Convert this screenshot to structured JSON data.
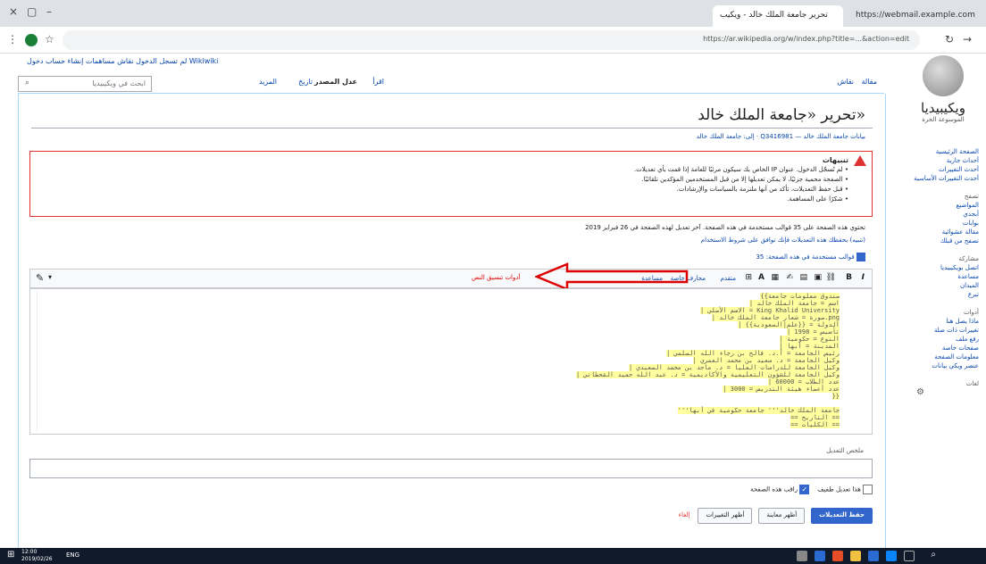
{
  "browser": {
    "tab_active_title": "تحرير جامعة الملك خالد - ويكيب",
    "tab_other_title": "https://webmail.example.com",
    "url": "https://ar.wikipedia.org/w/index.php?title=...&action=edit",
    "minimize": "–",
    "maximize": "▢",
    "close": "×"
  },
  "wiki": {
    "logo_title": "ويكيبيديا",
    "logo_subtitle": "الموسوعة الحرة",
    "user_tools": "Wikiwiki لم تسجل الدخول نقاش مساهمات إنشاء حساب دخول",
    "search_placeholder": "ابحث في ويكيبيديا",
    "tabs": [
      "مقالة",
      "نقاش",
      "اقرأ",
      "عدل المصدر",
      "تاريخ",
      "المزيد"
    ],
    "page_title": "تحرير «جامعة الملك خالد»",
    "breadcrumb": "بيانات جامعة الملك خالد — Q3416981 · إلى: جامعة الملك خالد",
    "sidebar": {
      "group1": [
        "الصفحة الرئيسية",
        "أحداث جارية",
        "أحدث التغييرات",
        "أحدث التغييرات الأساسية"
      ],
      "head2": "تصفح",
      "group2": [
        "المواضيع",
        "أبجدي",
        "بوابات",
        "مقالة عشوائية",
        "تصفح من قبلك"
      ],
      "head3": "مشاركة",
      "group3": [
        "اتصل بويكيبيديا",
        "مساعدة",
        "الميدان",
        "تبرع"
      ],
      "head4": "أدوات",
      "group4": [
        "ماذا يصل هنا",
        "تغييرات ذات صلة",
        "رفع ملف",
        "صفحات خاصة",
        "معلومات الصفحة",
        "عنصر ويكي بيانات"
      ],
      "head5": "لغات"
    }
  },
  "warning": {
    "title": "تنبيهات",
    "items": [
      "لم تُسجّل الدخول. عنوان IP الخاص بك سيكون مرئيًا للعامة إذا قمت بأي تعديلات.",
      "الصفحة محمية جزئيًا، لا يمكن تعديلها إلا من قبل المستخدمين المؤكدين تلقائيًا.",
      "قبل حفظ التعديلات، تأكد من أنها ملتزمة بالسياسات والإرشادات.",
      "شكرًا على المساهمة."
    ]
  },
  "notes": {
    "protection": "تحتوي هذه الصفحة على 35 قوالب مستخدمة في هذه الصفحة. آخر تعديل لهذه الصفحة في 26 فبراير 2019",
    "copyright": "(تنبيه) بحفظك هذه التعديلات فإنك توافق على شروط الاستخدام",
    "templates": "قوالب مستخدمة في هذه الصفحة: 35"
  },
  "toolbar": {
    "annotation": "أدوات تنسيق النص",
    "menu_items": [
      "متقدم",
      "محارف خاصة",
      "مساعدة"
    ]
  },
  "editor": {
    "lines": [
      "{{صندوق معلومات جامعة",
      "| اسم = جامعة الملك خالد",
      "| الاسم الأصلي = King Khalid University",
      "| صورة = شعار جامعة الملك خالد.png",
      "| الدولة = {{علم|السعودية}}",
      "| تأسيس = 1998",
      "| النوع = حكومية",
      "| المدينة = أبها",
      "| رئيس الجامعة = أ.د. فالح بن رجاء الله السلمي",
      "| وكيل الجامعة = د. سعيد بن محمد العمري",
      "| وكيل الجامعة للدراسات العليا = د. ماجد بن محمد السعيدي",
      "| وكيل الجامعة للشؤون التعليمية والأكاديمية = د. عبد الله حميد القحطاني",
      "| عدد الطلاب = 60000",
      "| عدد أعضاء هيئة التدريس = 3000",
      "}}",
      "'''جامعة الملك خالد''' جامعة حكومية في أبها",
      "== التاريخ ==",
      "== الكليات =="
    ]
  },
  "form": {
    "summary_label": "ملخص التعديل",
    "minor_edit": "هذا تعديل طفيف",
    "watch_page": "راقب هذه الصفحة",
    "save_button": "حفظ التعديلات",
    "preview_button": "أظهر معاينة",
    "diff_button": "أظهر التغييرات",
    "cancel_link": "إلغاء"
  },
  "taskbar": {
    "clock_time": "12:00",
    "clock_date": "2019/02/26",
    "tray": "ENG"
  },
  "colors": {
    "warning_border": "#dd3333",
    "code_highlight": "#ffffa0",
    "save_button": "#3366cc",
    "arrow": "#dd0000"
  }
}
